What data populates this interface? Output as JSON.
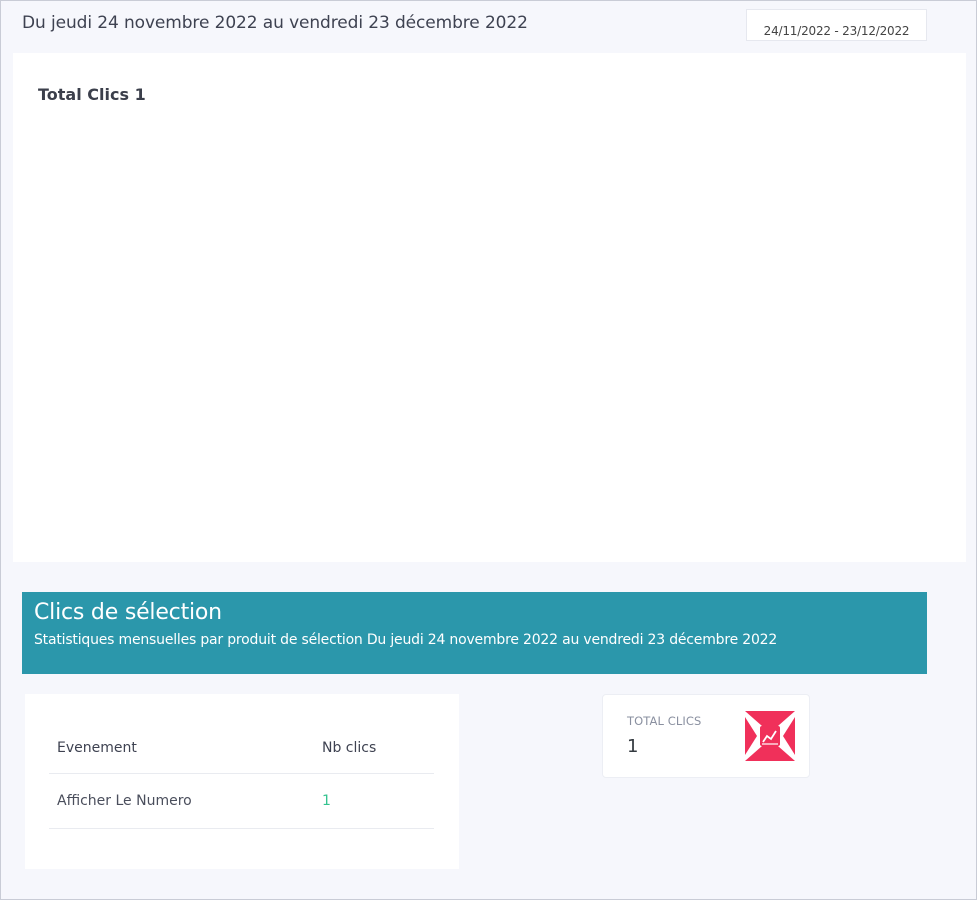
{
  "header": {
    "period_text": "Du jeudi 24 novembre 2022 au vendredi 23 décembre 2022",
    "date_range_value": "24/11/2022 - 23/12/2022"
  },
  "chart": {
    "title": "Total Clics 1"
  },
  "banner": {
    "title": "Clics de sélection",
    "subtitle": "Statistiques mensuelles par produit de sélection Du jeudi 24 novembre 2022 au vendredi 23 décembre 2022",
    "color": "#2b97ab"
  },
  "table": {
    "headers": [
      "Evenement",
      "Nb clics"
    ],
    "rows": [
      {
        "event": "Afficher Le Numero",
        "clicks": "1"
      }
    ]
  },
  "kpi": {
    "label": "TOTAL CLICS",
    "value": "1",
    "icon": "chart-icon",
    "icon_color": "#f0305a"
  }
}
